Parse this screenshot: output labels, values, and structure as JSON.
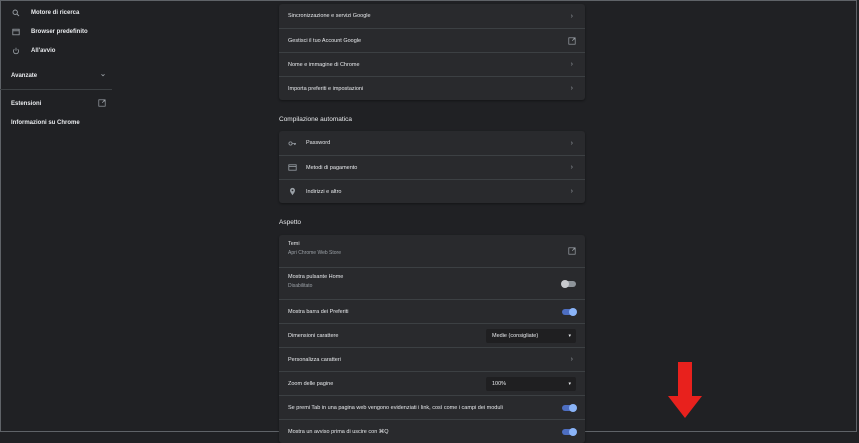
{
  "sidebar": {
    "items": [
      {
        "label": "Motore di ricerca",
        "icon": "search-icon"
      },
      {
        "label": "Browser predefinito",
        "icon": "browser-icon"
      },
      {
        "label": "All'avvio",
        "icon": "power-icon"
      }
    ],
    "advanced_label": "Avanzate",
    "extensions_label": "Estensioni",
    "about_label": "Informazioni su Chrome"
  },
  "people": {
    "rows": [
      {
        "label": "Sincronizzazione e servizi Google"
      },
      {
        "label": "Gestisci il tuo Account Google"
      },
      {
        "label": "Nome e immagine di Chrome"
      },
      {
        "label": "Importa preferiti e impostazioni"
      }
    ]
  },
  "autofill": {
    "title": "Compilazione automatica",
    "rows": [
      {
        "label": "Password",
        "icon": "key-icon"
      },
      {
        "label": "Metodi di pagamento",
        "icon": "credit-card-icon"
      },
      {
        "label": "Indirizzi e altro",
        "icon": "location-pin-icon"
      }
    ]
  },
  "appearance": {
    "title": "Aspetto",
    "themes_label": "Temi",
    "themes_sub": "Apri Chrome Web Store",
    "home_label": "Mostra pulsante Home",
    "home_sub": "Disabilitato",
    "home_on": false,
    "bookmarks_label": "Mostra barra dei Preferiti",
    "bookmarks_on": true,
    "font_size_label": "Dimensioni carattere",
    "font_size_value": "Medie (consigliate)",
    "customize_fonts_label": "Personalizza caratteri",
    "zoom_label": "Zoom delle pagine",
    "zoom_value": "100%",
    "tab_highlight_label": "Se premi Tab in una pagina web vengono evidenziati i link, così come i campi dei moduli",
    "tab_highlight_on": true,
    "quit_warning_label": "Mostra un avviso prima di uscire con ⌘Q",
    "quit_warning_on": true
  },
  "colors": {
    "background": "#202124",
    "card": "#292a2d",
    "accent": "#8ab4f8",
    "annotation_arrow": "#e8211d"
  }
}
